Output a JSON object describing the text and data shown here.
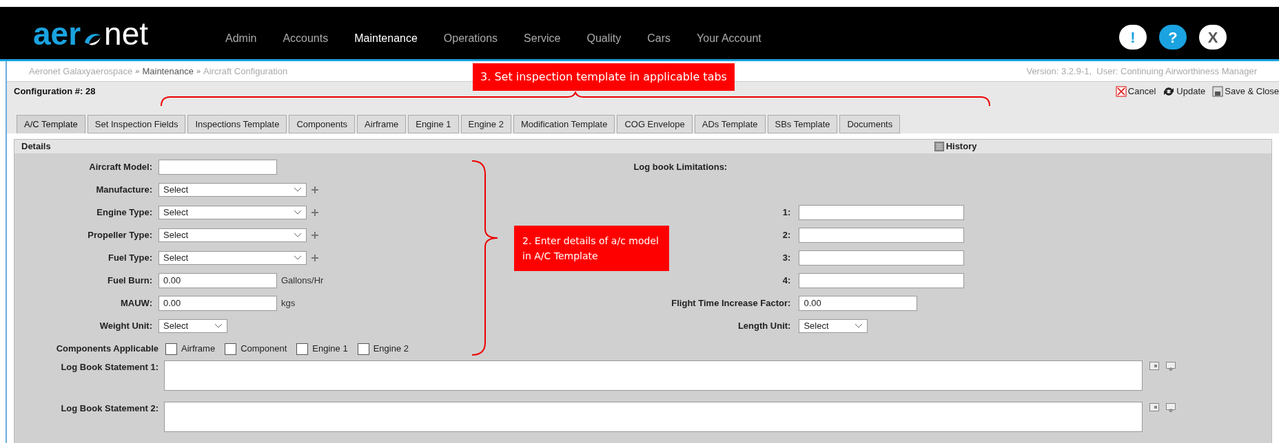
{
  "header": {
    "logo": {
      "left": "aer",
      "right": "net"
    },
    "nav": [
      {
        "label": "Admin",
        "selected": false
      },
      {
        "label": "Accounts",
        "selected": false
      },
      {
        "label": "Maintenance",
        "selected": true
      },
      {
        "label": "Operations",
        "selected": false
      },
      {
        "label": "Service",
        "selected": false
      },
      {
        "label": "Quality",
        "selected": false
      },
      {
        "label": "Cars",
        "selected": false
      },
      {
        "label": "Your Account",
        "selected": false
      }
    ],
    "buttons": [
      {
        "symbol": "!",
        "kind": "alert"
      },
      {
        "symbol": "?",
        "kind": "help"
      },
      {
        "symbol": "X",
        "kind": "close"
      }
    ]
  },
  "breadcrumb": [
    {
      "text": "Aeronet Galaxyaerospace",
      "kind": "link"
    },
    {
      "text": "»",
      "kind": "separator"
    },
    {
      "text": "Maintenance",
      "kind": "section"
    },
    {
      "text": "»",
      "kind": "separator"
    },
    {
      "text": "Aircraft Configuration",
      "kind": "page"
    }
  ],
  "version_info": "Version: 3.2.9-1,  User: Continuing Airworthiness Manager",
  "configuration_title": "Configuration #: 28",
  "toolbar": [
    {
      "label": "Cancel",
      "kind": "cancel"
    },
    {
      "label": "Update",
      "kind": "update"
    },
    {
      "label": "Save & Close",
      "kind": "save"
    }
  ],
  "tabs": [
    {
      "label": "A/C Template",
      "selected": true
    },
    {
      "label": "Set Inspection Fields",
      "selected": false
    },
    {
      "label": "Inspections Template",
      "selected": false
    },
    {
      "label": "Components",
      "selected": false
    },
    {
      "label": "Airframe",
      "selected": false
    },
    {
      "label": "Engine 1",
      "selected": false
    },
    {
      "label": "Engine 2",
      "selected": false
    },
    {
      "label": "Modification Template",
      "selected": false
    },
    {
      "label": "COG Envelope",
      "selected": false
    },
    {
      "label": "ADs Template",
      "selected": false
    },
    {
      "label": "SBs Template",
      "selected": false
    },
    {
      "label": "Documents",
      "selected": false
    }
  ],
  "details": {
    "title": "Details",
    "history_label": "History"
  },
  "left_fields": [
    {
      "label": "Aircraft Model:",
      "kind": "text"
    },
    {
      "label": "Manufacture:",
      "kind": "select",
      "value": "Select",
      "addable": true
    },
    {
      "label": "Engine Type:",
      "kind": "select",
      "value": "Select",
      "addable": true
    },
    {
      "label": "Propeller Type:",
      "kind": "select",
      "value": "Select",
      "addable": true
    },
    {
      "label": "Fuel Type:",
      "kind": "select",
      "value": "Select",
      "addable": true
    },
    {
      "label": "Fuel Burn:",
      "kind": "text",
      "value": "0.00",
      "unit": "Gallons/Hr"
    },
    {
      "label": "MAUW:",
      "kind": "text",
      "value": "0.00",
      "unit": "kgs"
    },
    {
      "label": "Weight Unit:",
      "kind": "select",
      "value": "Select",
      "addable": false
    }
  ],
  "right_heading": "Log book Limitations:",
  "right_fields": [
    {
      "label": "1:",
      "kind": "text"
    },
    {
      "label": "2:",
      "kind": "text"
    },
    {
      "label": "3:",
      "kind": "text"
    },
    {
      "label": "4:",
      "kind": "text"
    },
    {
      "label": "Flight Time Increase Factor:",
      "kind": "text",
      "value": "0.00"
    },
    {
      "label": "Length Unit:",
      "kind": "select",
      "value": "Select"
    }
  ],
  "components_applicable": {
    "label": "Components Applicable",
    "options": [
      {
        "label": "Airframe",
        "checked": false
      },
      {
        "label": "Component",
        "checked": false
      },
      {
        "label": "Engine 1",
        "checked": false
      },
      {
        "label": "Engine 2",
        "checked": false
      }
    ]
  },
  "log_book_statements": [
    {
      "label": "Log Book Statement 1:"
    },
    {
      "label": "Log Book Statement 2:"
    }
  ],
  "annotations": [
    {
      "text": "3. Set inspection template in applicable tabs",
      "kind": "horizontal"
    },
    {
      "text": "2. Enter details of a/c model in A/C Template",
      "kind": "vertical"
    }
  ]
}
